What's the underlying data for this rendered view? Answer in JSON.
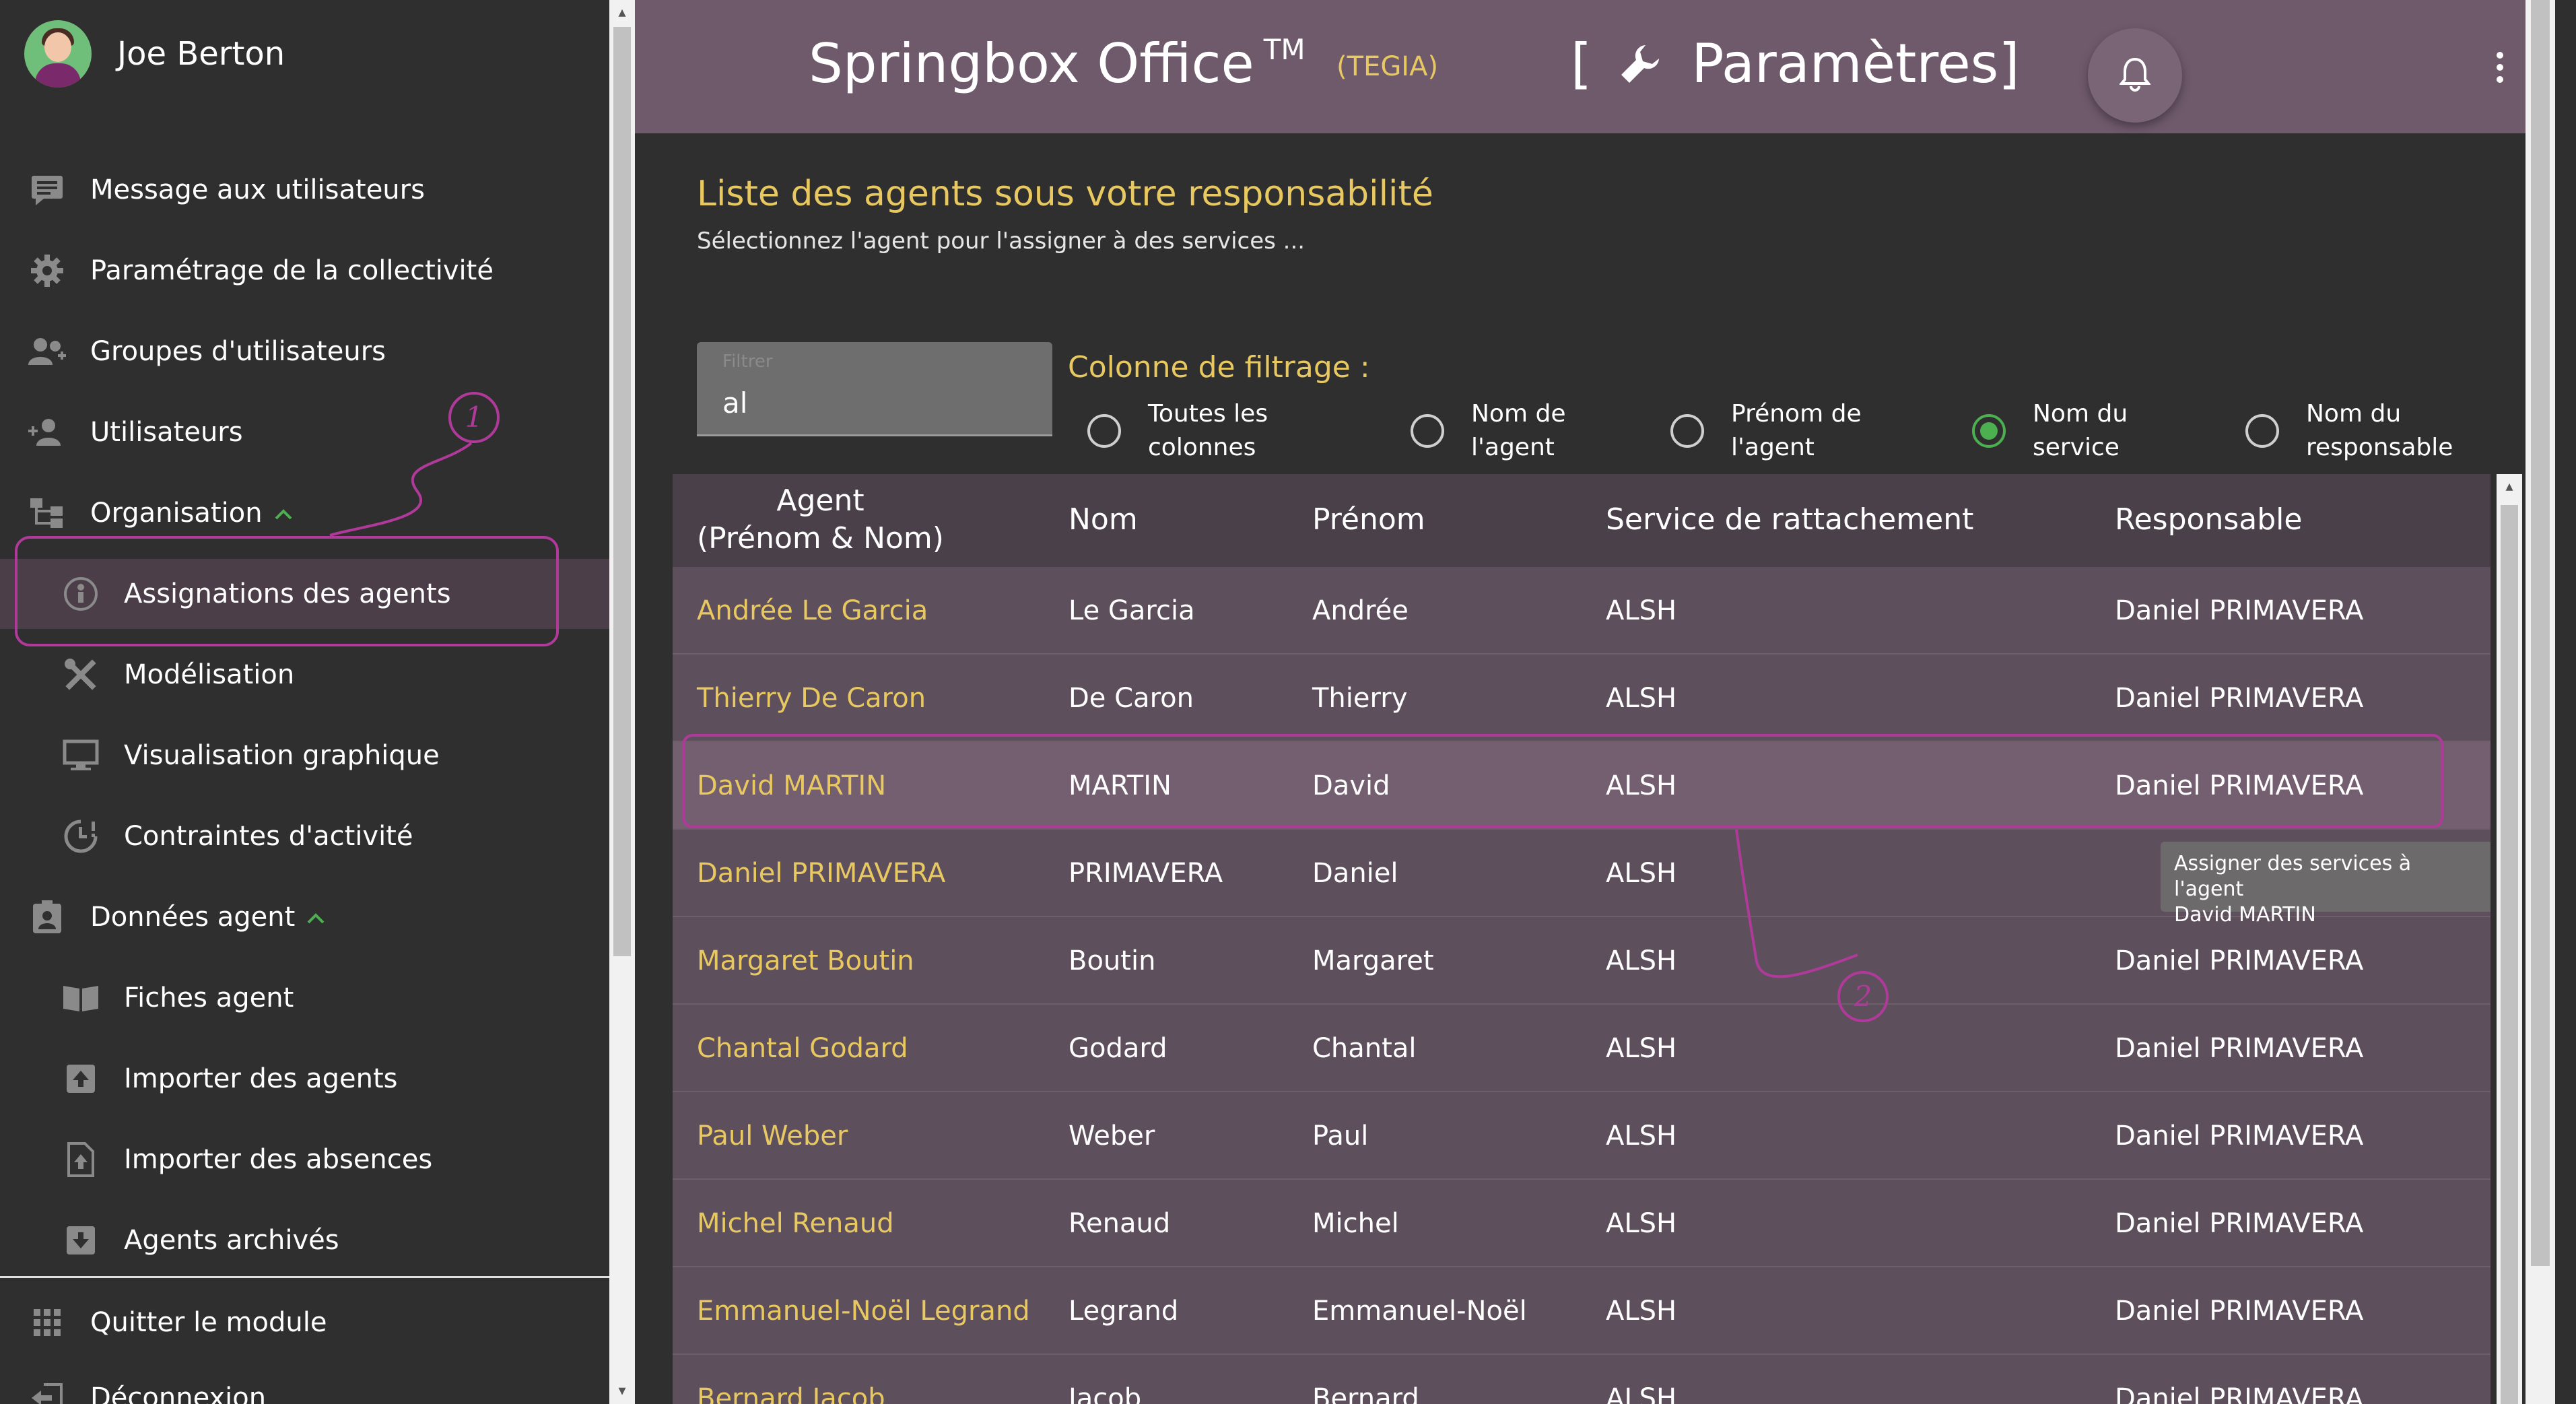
{
  "user": {
    "name": "Joe Berton"
  },
  "sidebar": {
    "items": [
      {
        "label": "Message aux utilisateurs",
        "icon": "message-icon"
      },
      {
        "label": "Paramétrage de la collectivité",
        "icon": "gear-icon"
      },
      {
        "label": "Groupes d'utilisateurs",
        "icon": "group-icon"
      },
      {
        "label": "Utilisateurs",
        "icon": "user-add-icon"
      },
      {
        "label": "Organisation",
        "icon": "org-icon"
      },
      {
        "label": "Assignations des agents",
        "icon": "assign-icon"
      },
      {
        "label": "Modélisation",
        "icon": "tools-icon"
      },
      {
        "label": "Visualisation graphique",
        "icon": "monitor-icon"
      },
      {
        "label": "Contraintes d'activité",
        "icon": "clock-alert-icon"
      },
      {
        "label": "Données agent",
        "icon": "badge-icon"
      },
      {
        "label": "Fiches agent",
        "icon": "book-icon"
      },
      {
        "label": "Importer des agents",
        "icon": "import-icon"
      },
      {
        "label": "Importer des absences",
        "icon": "file-import-icon"
      },
      {
        "label": "Agents archivés",
        "icon": "archive-icon"
      },
      {
        "label": "Quitter le module",
        "icon": "grid-icon"
      },
      {
        "label": "Déconnexion",
        "icon": "logout-icon"
      }
    ]
  },
  "annotations": {
    "one": "1",
    "two": "2"
  },
  "header": {
    "app_title": "Springbox Office",
    "trademark": "TM",
    "org": "(TEGIA)",
    "bracket_open": "[",
    "section": "Paramètres]"
  },
  "main": {
    "title": "Liste des agents sous votre responsabilité",
    "subtitle": "Sélectionnez l'agent pour l'assigner à des services ...",
    "filter": {
      "label": "Filtrer",
      "value": "al"
    },
    "filter_column_label": "Colonne de filtrage :",
    "radio_options": [
      {
        "line1": "Toutes les",
        "line2": "colonnes",
        "checked": false
      },
      {
        "line1": "Nom de",
        "line2": "l'agent",
        "checked": false
      },
      {
        "line1": "Prénom de",
        "line2": "l'agent",
        "checked": false
      },
      {
        "line1": "Nom du",
        "line2": "service",
        "checked": true
      },
      {
        "line1": "Nom du",
        "line2": "responsable",
        "checked": false
      }
    ]
  },
  "table": {
    "headers": [
      "Agent",
      "(Prénom & Nom)",
      "Nom",
      "Prénom",
      "Service de rattachement",
      "Responsable"
    ],
    "rows": [
      {
        "agent": "Andrée Le Garcia",
        "nom": "Le Garcia",
        "prenom": "Andrée",
        "service": "ALSH",
        "responsable": "Daniel PRIMAVERA"
      },
      {
        "agent": "Thierry De Caron",
        "nom": "De Caron",
        "prenom": "Thierry",
        "service": "ALSH",
        "responsable": "Daniel PRIMAVERA"
      },
      {
        "agent": "David MARTIN",
        "nom": "MARTIN",
        "prenom": "David",
        "service": "ALSH",
        "responsable": "Daniel PRIMAVERA"
      },
      {
        "agent": "Daniel PRIMAVERA",
        "nom": "PRIMAVERA",
        "prenom": "Daniel",
        "service": "ALSH",
        "responsable": ""
      },
      {
        "agent": "Margaret Boutin",
        "nom": "Boutin",
        "prenom": "Margaret",
        "service": "ALSH",
        "responsable": "Daniel PRIMAVERA"
      },
      {
        "agent": "Chantal Godard",
        "nom": "Godard",
        "prenom": "Chantal",
        "service": "ALSH",
        "responsable": "Daniel PRIMAVERA"
      },
      {
        "agent": "Paul Weber",
        "nom": "Weber",
        "prenom": "Paul",
        "service": "ALSH",
        "responsable": "Daniel PRIMAVERA"
      },
      {
        "agent": "Michel Renaud",
        "nom": "Renaud",
        "prenom": "Michel",
        "service": "ALSH",
        "responsable": "Daniel PRIMAVERA"
      },
      {
        "agent": "Emmanuel-Noël Legrand",
        "nom": "Legrand",
        "prenom": "Emmanuel-Noël",
        "service": "ALSH",
        "responsable": "Daniel PRIMAVERA"
      },
      {
        "agent": "Bernard Jacob",
        "nom": "Jacob",
        "prenom": "Bernard",
        "service": "ALSH",
        "responsable": "Daniel PRIMAVERA"
      }
    ],
    "tooltip": {
      "line1": "Assigner des services à l'agent",
      "line2": "David MARTIN"
    }
  },
  "colors": {
    "header_bg": "#6f5a6c",
    "accent_yellow": "#e8c860",
    "radio_checked": "#4caf50",
    "annotation": "#b03a9a"
  }
}
